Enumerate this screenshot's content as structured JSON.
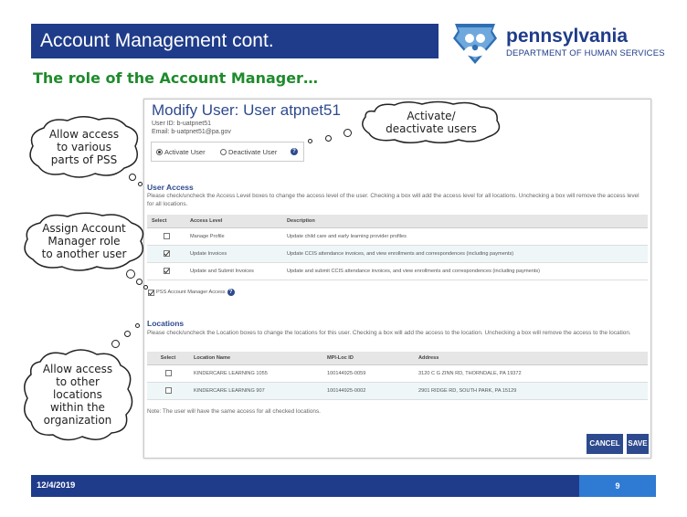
{
  "slide": {
    "title": "Account Management cont.",
    "subtitle": "The role of the Account Manager…",
    "logo": {
      "word": "pennsylvania",
      "sub": "DEPARTMENT OF HUMAN SERVICES",
      "icon": "keystone-family-icon"
    },
    "footer": {
      "date": "12/4/2019",
      "page": "9"
    }
  },
  "callouts": {
    "activate": "Activate/\ndeactivate users",
    "access": "Allow access\nto various\nparts of PSS",
    "assign": "Assign Account\nManager role\nto another user",
    "locations": "Allow access\nto other\nlocations\nwithin the\norganization"
  },
  "screen": {
    "title": "Modify User: User atpnet51",
    "user_id": "User ID: b-uatpnet51",
    "email": "Email: b-uatpnet51@pa.gov",
    "activate_label": "Activate User",
    "deactivate_label": "Deactivate User",
    "activate_selected": true,
    "user_access": {
      "heading": "User Access",
      "text": "Please check/uncheck the Access Level boxes to change the access level of the user. Checking a box will add the access level for all locations. Unchecking a box will remove the access level for all locations.",
      "columns": [
        "Select",
        "Access Level",
        "Description"
      ],
      "rows": [
        {
          "checked": false,
          "level": "Manage Profile",
          "description": "Update child care and early learning provider profiles"
        },
        {
          "checked": true,
          "level": "Update Invoices",
          "description": "Update CCIS attendance invoices, and view enrollments and correspondences (including payments)"
        },
        {
          "checked": true,
          "level": "Update and Submit Invoices",
          "description": "Update and submit CCIS attendance invoices, and view enrollments and correspondences (including payments)"
        }
      ]
    },
    "pss_account_manager": {
      "label": "PSS Account Manager Access",
      "checked": true
    },
    "locations": {
      "heading": "Locations",
      "text": "Please check/uncheck the Location boxes to change the locations for this user. Checking a box will add the access to the location. Unchecking a box will remove the access to the location.",
      "columns": [
        "Select",
        "Location Name",
        "MPI-Loc ID",
        "Address"
      ],
      "rows": [
        {
          "checked": false,
          "name": "KINDERCARE LEARNING 1055",
          "mpi": "100144925-0059",
          "address": "3120 C G ZINN RD, THORNDALE, PA 19372"
        },
        {
          "checked": false,
          "name": "KINDERCARE LEARNING 907",
          "mpi": "100144925-0002",
          "address": "2901 RIDGE RD, SOUTH PARK, PA 15129"
        }
      ]
    },
    "note": "Note: The user will have the same access for all checked locations.",
    "cancel_label": "CANCEL",
    "save_label": "SAVE"
  },
  "colors": {
    "title_bar": "#1f3c8a",
    "subtitle": "#1f8b2c",
    "page_box": "#2f7ad3",
    "button": "#2e4a8e"
  }
}
